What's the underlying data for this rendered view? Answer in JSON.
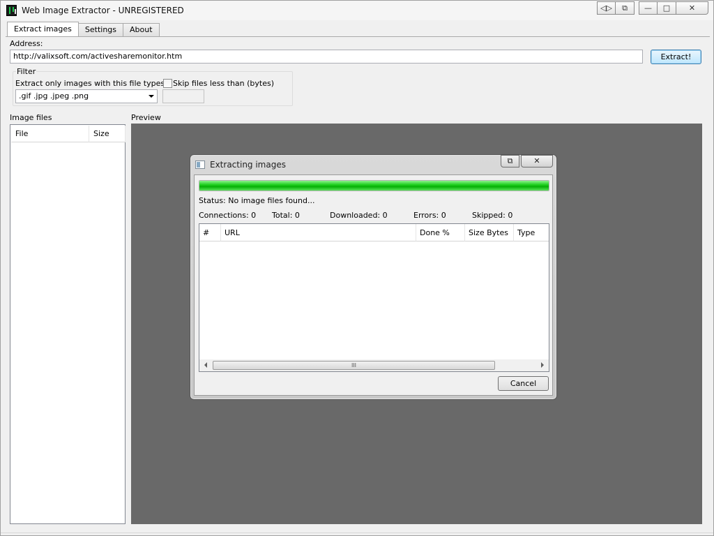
{
  "window": {
    "title": "Web Image Extractor - UNREGISTERED",
    "buttons": {
      "b1": "◁▷",
      "b2": "⧉",
      "minimize": "—",
      "maximize": "□",
      "close": "✕"
    }
  },
  "tabs": [
    {
      "label": "Extract images",
      "active": true
    },
    {
      "label": "Settings",
      "active": false
    },
    {
      "label": "About",
      "active": false
    }
  ],
  "address": {
    "label": "Address:",
    "value": "http://valixsoft.com/activesharemonitor.htm",
    "extract_button": "Extract!"
  },
  "filter": {
    "legend": "Filter",
    "types_label": "Extract only images with this file types",
    "types_value": ".gif .jpg .jpeg .png",
    "skip_label": "Skip files less than (bytes)",
    "skip_checked": false,
    "skip_value": ""
  },
  "image_files": {
    "label": "Image files",
    "columns": [
      "File",
      "Size"
    ]
  },
  "preview": {
    "label": "Preview"
  },
  "dialog": {
    "title": "Extracting images",
    "help_button": "⧉",
    "close_button": "✕",
    "progress_percent": 100,
    "progress_color": "#1bc41b",
    "status": "Status: No image files found...",
    "stats": {
      "connections": "Connections: 0",
      "total": "Total: 0",
      "downloaded": "Downloaded: 0",
      "errors": "Errors: 0",
      "skipped": "Skipped: 0"
    },
    "columns": [
      "#",
      "URL",
      "Done %",
      "Size Bytes",
      "Type"
    ],
    "scroll_grip": "III",
    "cancel_button": "Cancel"
  },
  "colors": {
    "preview_bg": "#696969",
    "extract_button_accent": "#3c7fb1"
  }
}
